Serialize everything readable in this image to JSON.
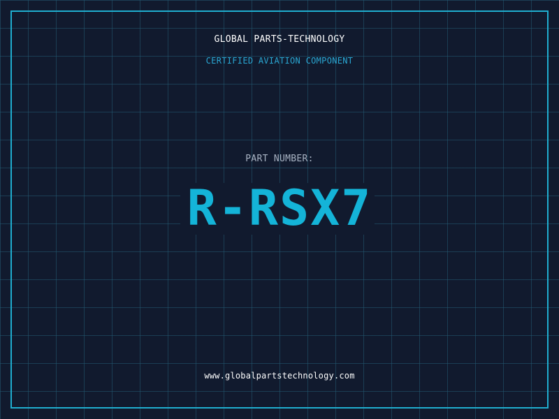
{
  "header": {
    "company": "GLOBAL PARTS-TECHNOLOGY",
    "tagline": "CERTIFIED AVIATION COMPONENT"
  },
  "part": {
    "label": "PART NUMBER:",
    "number": "R-RSX7"
  },
  "footer": {
    "url": "www.globalpartstechnology.com"
  },
  "colors": {
    "background": "#111a2e",
    "grid": "#235a73",
    "frame": "#1faed0",
    "accent": "#14b4d8",
    "tagline": "#2aa8d4",
    "label": "#a9b4c4",
    "text": "#ffffff"
  }
}
